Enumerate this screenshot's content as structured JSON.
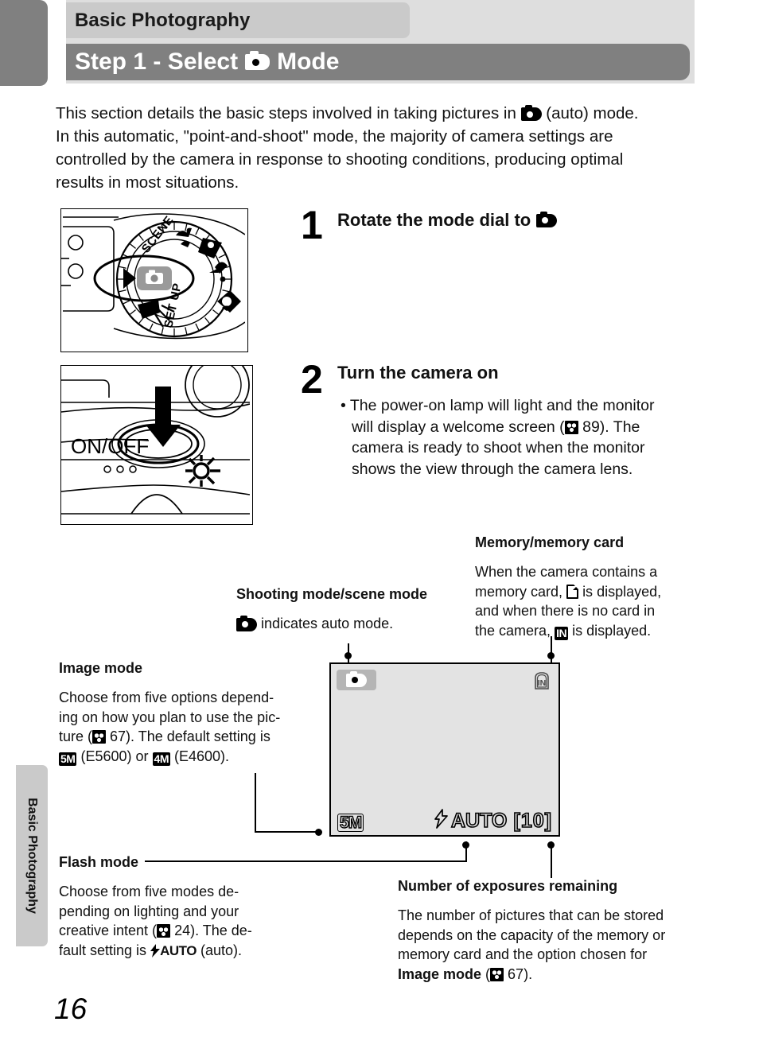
{
  "header": {
    "chapter": "Basic Photography",
    "step_title_pre": "Step 1 - Select",
    "step_title_post": "Mode",
    "mode_icon": "camera-auto-icon"
  },
  "intro": {
    "line1": "This section details the basic steps involved in taking pictures in",
    "line1b": "(auto) mode.",
    "line2": "In this automatic, \"point-and-shoot\" mode, the majority of camera settings are",
    "line3": "controlled by the camera in response to shooting conditions, producing optimal",
    "line4": "results in most situations."
  },
  "figures": {
    "mode_dial": {
      "name": "mode-dial-illustration",
      "labels": [
        "SCENE",
        "SET UP"
      ],
      "selected": "camera-auto-icon"
    },
    "power_switch": {
      "name": "power-switch-illustration",
      "label": "ON/OFF"
    }
  },
  "steps": [
    {
      "number": "1",
      "heading": "Rotate the mode dial to",
      "heading_icon": "camera-auto-icon",
      "body": []
    },
    {
      "number": "2",
      "heading": "Turn the camera on",
      "body": [
        "• The power-on lamp will light and the monitor",
        "will display a welcome screen (",
        "89). The",
        "camera is ready to shoot when the monitor",
        "shows the view through the camera lens."
      ],
      "page_ref": "89"
    }
  ],
  "callouts": {
    "memory_card": {
      "title": "Memory/memory card",
      "line1": "When the camera contains a",
      "line2a": "memory card,",
      "line2b": "is displayed,",
      "line3": "and when there is no card in",
      "line4a": "the camera,",
      "line4b": "is displayed.",
      "card_icon": "memory-card-icon",
      "internal_icon": "IN"
    },
    "shooting_mode": {
      "title": "Shooting mode/scene mode",
      "body": "indicates auto mode.",
      "icon": "camera-auto-icon"
    },
    "image_mode": {
      "title": "Image mode",
      "line1": "Choose from five options depend-",
      "line2": "ing on how you plan to use the pic-",
      "line3a": "ture (",
      "line3b": "67). The default setting is",
      "line4a": "(E5600) or",
      "line4b": "(E4600).",
      "page_ref": "67",
      "badge_5m": "5M",
      "badge_4m": "4M"
    },
    "flash_mode": {
      "title": "Flash mode",
      "line1": "Choose from five modes de-",
      "line2": "pending on lighting and your",
      "line3a": "creative intent (",
      "line3b": "24). The de-",
      "line4a": "fault setting is",
      "line4b": "(auto).",
      "page_ref": "24",
      "flash_label": "AUTO"
    },
    "exposures": {
      "title": "Number of exposures remaining",
      "line1": "The number of pictures that can be stored",
      "line2": "depends on the capacity of the memory or",
      "line3": "memory card and the option chosen for",
      "line4a": "Image mode",
      "line4b": "67).",
      "page_ref": "67"
    }
  },
  "lcd": {
    "mode_icon": "camera-auto-icon",
    "memory_indicator": "IN",
    "image_mode": "5M",
    "flash_mode": "AUTO",
    "exposures_remaining": "10",
    "bracket_left": "[",
    "bracket_right": "]"
  },
  "side_tab": {
    "label": "Basic Photography"
  },
  "footer": {
    "page_number": "16"
  },
  "colors": {
    "chapter_bar": "#cacaca",
    "step_bar": "#808080",
    "lcd_bg": "#e3e3e3",
    "edge_tab": "#808080"
  }
}
